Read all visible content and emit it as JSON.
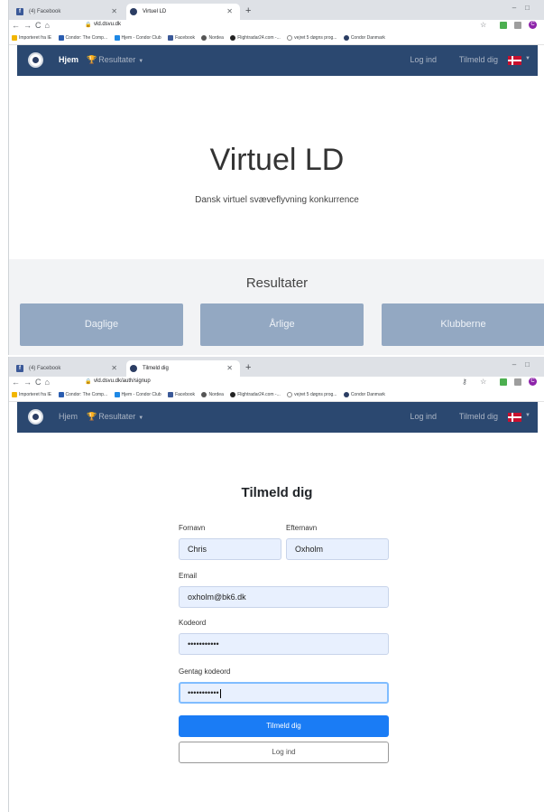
{
  "window1": {
    "tabs": [
      {
        "label": "(4) Facebook",
        "icon": "facebook-icon"
      },
      {
        "label": "Virtuel LD",
        "icon": "virtuel-ld-icon"
      }
    ],
    "url": "vld.dsvu.dk",
    "bookmarks": [
      "Importeret fra IE",
      "Condor: The Comp...",
      "Hjem - Condor Club",
      "Facebook",
      "Nordea",
      "Flightradar24.com -...",
      "vejret 5 døgns prog...",
      "Condor Danmark"
    ],
    "nav": {
      "home": "Hjem",
      "results": "Resultater",
      "login": "Log ind",
      "signup": "Tilmeld dig"
    },
    "hero": {
      "title": "Virtuel LD",
      "subtitle": "Dansk virtuel svæveflyvning konkurrence"
    },
    "results": {
      "title": "Resultater",
      "buttons": [
        "Daglige",
        "Årlige",
        "Klubberne"
      ]
    }
  },
  "window2": {
    "tabs": [
      {
        "label": "(4) Facebook",
        "icon": "facebook-icon"
      },
      {
        "label": "Tilmeld dig",
        "icon": "virtuel-ld-icon"
      }
    ],
    "url": "vld.dsvu.dk/auth/signup",
    "bookmarks": [
      "Importeret fra IE",
      "Condor: The Comp...",
      "Hjem - Condor Club",
      "Facebook",
      "Nordea",
      "Flightradar24.com -...",
      "vejret 5 døgns prog...",
      "Condor Danmark"
    ],
    "nav": {
      "home": "Hjem",
      "results": "Resultater",
      "login": "Log ind",
      "signup": "Tilmeld dig"
    },
    "form": {
      "title": "Tilmeld dig",
      "firstname_label": "Fornavn",
      "firstname_value": "Chris",
      "lastname_label": "Efternavn",
      "lastname_value": "Oxholm",
      "email_label": "Email",
      "email_value": "oxholm@bk6.dk",
      "password_label": "Kodeord",
      "password_value": "•••••••••••",
      "repeat_label": "Gentag kodeord",
      "repeat_value": "•••••••••••",
      "submit_label": "Tilmeld dig",
      "login_label": "Log ind"
    }
  },
  "colors": {
    "navbar": "#2b4870",
    "results_button": "#93a8c2",
    "primary_button": "#1a7cf5",
    "autofill": "#e8f0fe"
  }
}
